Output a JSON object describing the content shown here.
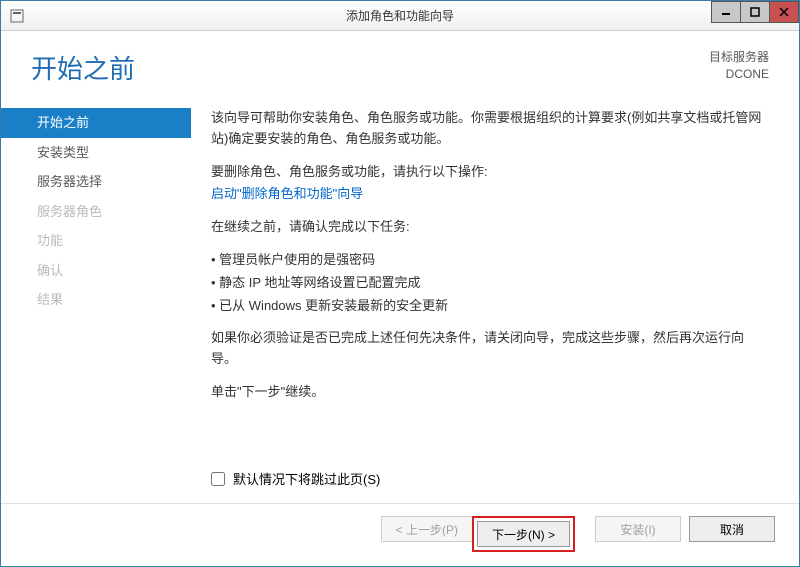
{
  "window": {
    "title": "添加角色和功能向导"
  },
  "header": {
    "page_title": "开始之前",
    "server_label": "目标服务器",
    "server_name": "DCONE"
  },
  "sidebar": {
    "items": [
      {
        "label": "开始之前",
        "state": "active"
      },
      {
        "label": "安装类型",
        "state": "inactive"
      },
      {
        "label": "服务器选择",
        "state": "inactive"
      },
      {
        "label": "服务器角色",
        "state": "disabled"
      },
      {
        "label": "功能",
        "state": "disabled"
      },
      {
        "label": "确认",
        "state": "disabled"
      },
      {
        "label": "结果",
        "state": "disabled"
      }
    ]
  },
  "content": {
    "intro": "该向导可帮助你安装角色、角色服务或功能。你需要根据组织的计算要求(例如共享文档或托管网站)确定要安装的角色、角色服务或功能。",
    "remove_label": "要删除角色、角色服务或功能，请执行以下操作:",
    "remove_link": "启动\"删除角色和功能\"向导",
    "before_continue": "在继续之前，请确认完成以下任务:",
    "tasks": [
      "管理员帐户使用的是强密码",
      "静态 IP 地址等网络设置已配置完成",
      "已从 Windows 更新安装最新的安全更新"
    ],
    "verify_text": "如果你必须验证是否已完成上述任何先决条件，请关闭向导，完成这些步骤，然后再次运行向导。",
    "continue_text": "单击\"下一步\"继续。"
  },
  "skip": {
    "label": "默认情况下将跳过此页(S)"
  },
  "buttons": {
    "previous": "< 上一步(P)",
    "next": "下一步(N) >",
    "install": "安装(I)",
    "cancel": "取消"
  }
}
